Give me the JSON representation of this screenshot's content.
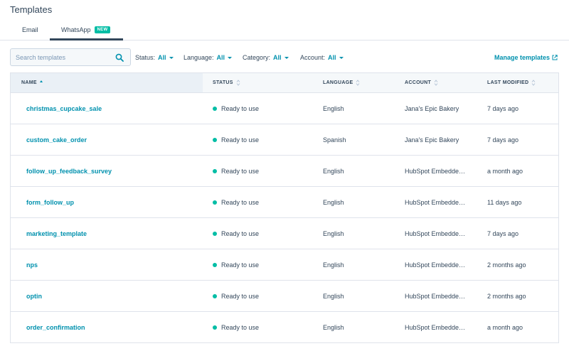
{
  "page": {
    "title": "Templates"
  },
  "tabs": [
    {
      "label": "Email"
    },
    {
      "label": "WhatsApp",
      "badge": "NEW"
    }
  ],
  "search": {
    "placeholder": "Search templates",
    "value": ""
  },
  "filters": {
    "status": {
      "label": "Status:",
      "value": "All"
    },
    "language": {
      "label": "Language:",
      "value": "All"
    },
    "category": {
      "label": "Category:",
      "value": "All"
    },
    "account": {
      "label": "Account:",
      "value": "All"
    }
  },
  "manage_link": "Manage templates",
  "table": {
    "columns": [
      "NAME",
      "STATUS",
      "LANGUAGE",
      "ACCOUNT",
      "LAST MODIFIED"
    ],
    "rows": [
      {
        "name": "christmas_cupcake_sale",
        "status": "Ready to use",
        "language": "English",
        "account": "Jana's Epic Bakery",
        "modified": "7 days ago"
      },
      {
        "name": "custom_cake_order",
        "status": "Ready to use",
        "language": "Spanish",
        "account": "Jana's Epic Bakery",
        "modified": "7 days ago"
      },
      {
        "name": "follow_up_feedback_survey",
        "status": "Ready to use",
        "language": "English",
        "account": "HubSpot Embedde…",
        "modified": "a month ago"
      },
      {
        "name": "form_follow_up",
        "status": "Ready to use",
        "language": "English",
        "account": "HubSpot Embedde…",
        "modified": "11 days ago"
      },
      {
        "name": "marketing_template",
        "status": "Ready to use",
        "language": "English",
        "account": "HubSpot Embedde…",
        "modified": "7 days ago"
      },
      {
        "name": "nps",
        "status": "Ready to use",
        "language": "English",
        "account": "HubSpot Embedde…",
        "modified": "2 months ago"
      },
      {
        "name": "optin",
        "status": "Ready to use",
        "language": "English",
        "account": "HubSpot Embedde…",
        "modified": "2 months ago"
      },
      {
        "name": "order_confirmation",
        "status": "Ready to use",
        "language": "English",
        "account": "HubSpot Embedde…",
        "modified": "a month ago"
      }
    ]
  },
  "colors": {
    "accent": "#0091ae",
    "status_ready": "#00bda5",
    "text": "#33475b",
    "badge": "#00bda5"
  },
  "icons": {
    "search": "search-icon",
    "external": "external-link-icon",
    "sort": "sort-icon"
  }
}
